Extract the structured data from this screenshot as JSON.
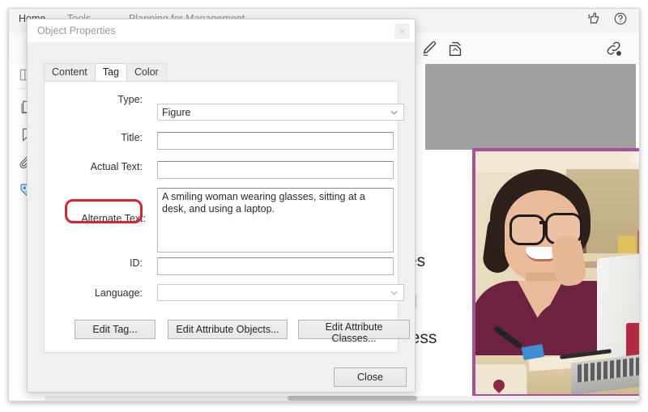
{
  "app": {
    "menu_tabs": [
      {
        "label": "Home",
        "occluded": false
      },
      {
        "label": "Tools",
        "occluded": true
      },
      {
        "label": "Planning for Management",
        "occluded": true
      }
    ],
    "topright_icons": [
      {
        "name": "feedback-thumbsup-icon"
      },
      {
        "name": "help-question-icon"
      }
    ],
    "toolbar_icons": [
      {
        "name": "sign-pen-icon"
      },
      {
        "name": "fill-and-sign-icon"
      },
      {
        "name": "share-link-icon"
      }
    ],
    "rail_icons": [
      {
        "name": "page-thumbnails-panel-icon"
      },
      {
        "name": "pages-copy-icon"
      },
      {
        "name": "bookmarks-icon"
      },
      {
        "name": "attachments-paperclip-icon"
      },
      {
        "name": "accessibility-tags-icon"
      }
    ],
    "rail_active_color": "#2f82c8"
  },
  "document": {
    "text_fragments": [
      "es",
      "d",
      "ness"
    ],
    "image": {
      "alt_description": "A smiling woman wearing glasses, sitting at a desk, and using a laptop.",
      "border_color": "#a6519a"
    }
  },
  "dialog": {
    "title": "Object Properties",
    "close_glyph": "×",
    "tabs": [
      {
        "label": "Content",
        "active": false
      },
      {
        "label": "Tag",
        "active": true
      },
      {
        "label": "Color",
        "active": false
      }
    ],
    "fields": {
      "type": {
        "label": "Type:",
        "value": "Figure",
        "control": "select"
      },
      "title": {
        "label": "Title:",
        "value": "",
        "control": "text"
      },
      "actual_text": {
        "label": "Actual Text:",
        "value": "",
        "control": "text"
      },
      "alternate_text": {
        "label": "Alternate Text:",
        "value": "A smiling woman wearing glasses, sitting at a desk, and using a laptop.",
        "control": "textarea",
        "highlighted": true,
        "highlight_color": "#d7242d"
      },
      "id": {
        "label": "ID:",
        "value": "",
        "control": "text"
      },
      "language": {
        "label": "Language:",
        "value": "",
        "control": "select"
      }
    },
    "buttons": {
      "edit_tag": "Edit Tag...",
      "edit_attribute_objects": "Edit Attribute Objects...",
      "edit_attribute_classes": "Edit Attribute Classes...",
      "close": "Close"
    }
  }
}
